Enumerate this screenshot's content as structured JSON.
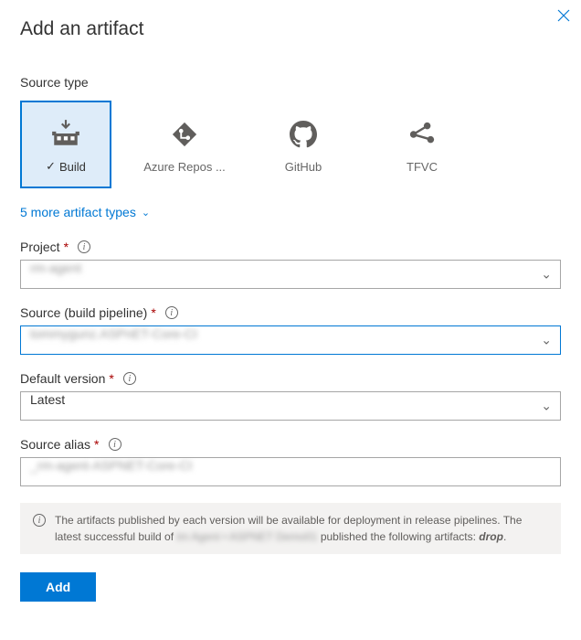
{
  "title": "Add an artifact",
  "source_type_label": "Source type",
  "tiles": [
    {
      "label": "Build",
      "icon": "build"
    },
    {
      "label": "Azure Repos ...",
      "icon": "azure-repos"
    },
    {
      "label": "GitHub",
      "icon": "github"
    },
    {
      "label": "TFVC",
      "icon": "tfvc"
    }
  ],
  "more_link": "5 more artifact types",
  "fields": {
    "project": {
      "label": "Project",
      "value": "rm-agent"
    },
    "source": {
      "label": "Source (build pipeline)",
      "value": "tommygunz.ASPnET-Core-CI"
    },
    "default_version": {
      "label": "Default version",
      "value": "Latest"
    },
    "source_alias": {
      "label": "Source alias",
      "value": "_rm-agent-ASPNET-Core-CI"
    }
  },
  "info_text_1": "The artifacts published by each version will be available for deployment in release pipelines. The latest successful build of",
  "info_text_2": "tm Agent • ASPNET Demo01",
  "info_text_3": "published the following artifacts:",
  "info_artifact": "drop",
  "add_button": "Add"
}
